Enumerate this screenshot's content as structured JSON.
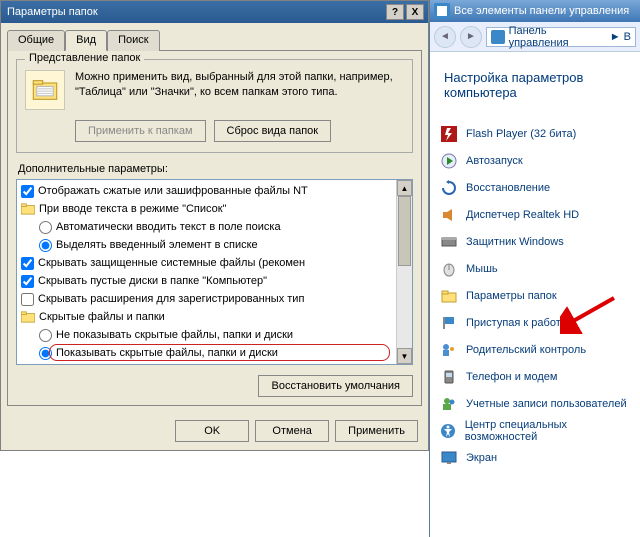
{
  "dialog": {
    "title": "Параметры папок",
    "close_help": "?",
    "close_x": "X",
    "tabs": {
      "general": "Общие",
      "view": "Вид",
      "search": "Поиск"
    },
    "folder_views": {
      "title": "Представление папок",
      "desc": "Можно применить вид, выбранный для этой папки, например, \"Таблица\" или \"Значки\", ко всем папкам этого типа.",
      "apply": "Применить к папкам",
      "reset": "Сброс вида папок"
    },
    "advanced_label": "Дополнительные параметры:",
    "tree": {
      "i0": "Отображать сжатые или зашифрованные файлы NT",
      "i1": "При вводе текста в режиме \"Список\"",
      "i2": "Автоматически вводить текст в поле поиска",
      "i3": "Выделять введенный элемент в списке",
      "i4": "Скрывать защищенные системные файлы (рекомен",
      "i5": "Скрывать пустые диски в папке \"Компьютер\"",
      "i6": "Скрывать расширения для зарегистрированных тип",
      "i7": "Скрытые файлы и папки",
      "i8": "Не показывать скрытые файлы, папки и диски",
      "i9": "Показывать скрытые файлы, папки и диски"
    },
    "restore": "Восстановить умолчания",
    "ok": "OK",
    "cancel": "Отмена",
    "apply": "Применить"
  },
  "cp": {
    "title": "Все элементы панели управления",
    "breadcrumb": "Панель управления",
    "breadcrumb_suffix": "В",
    "heading": "Настройка параметров компьютера",
    "items": [
      "Flash Player (32 бита)",
      "Автозапуск",
      "Восстановление",
      "Диспетчер Realtek HD",
      "Защитник Windows",
      "Мышь",
      "Параметры папок",
      "Приступая к работе",
      "Родительский контроль",
      "Телефон и модем",
      "Учетные записи пользователей",
      "Центр специальных возможностей",
      "Экран"
    ]
  }
}
